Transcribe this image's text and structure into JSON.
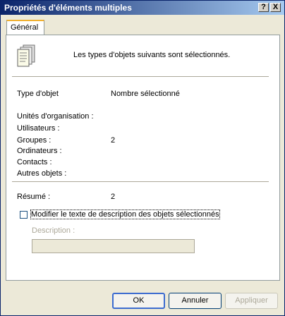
{
  "window": {
    "title": "Propriétés d'éléments multiples",
    "help_btn": "?",
    "close_btn": "X"
  },
  "tabs": [
    {
      "label": "Général"
    }
  ],
  "general": {
    "intro_text": "Les types d'objets suivants sont sélectionnés.",
    "header_type": "Type d'objet",
    "header_count": "Nombre sélectionné",
    "rows": [
      {
        "label": "Unités d'organisation :",
        "count": ""
      },
      {
        "label": "Utilisateurs :",
        "count": ""
      },
      {
        "label": "Groupes :",
        "count": "2"
      },
      {
        "label": "Ordinateurs :",
        "count": ""
      },
      {
        "label": "Contacts :",
        "count": ""
      },
      {
        "label": "Autres objets :",
        "count": ""
      }
    ],
    "summary_label": "Résumé :",
    "summary_count": "2",
    "modify_checkbox_label": "Modifier le texte de description des objets sélectionnés",
    "modify_checked": false,
    "description_label": "Description :",
    "description_value": ""
  },
  "buttons": {
    "ok": "OK",
    "cancel": "Annuler",
    "apply": "Appliquer"
  }
}
